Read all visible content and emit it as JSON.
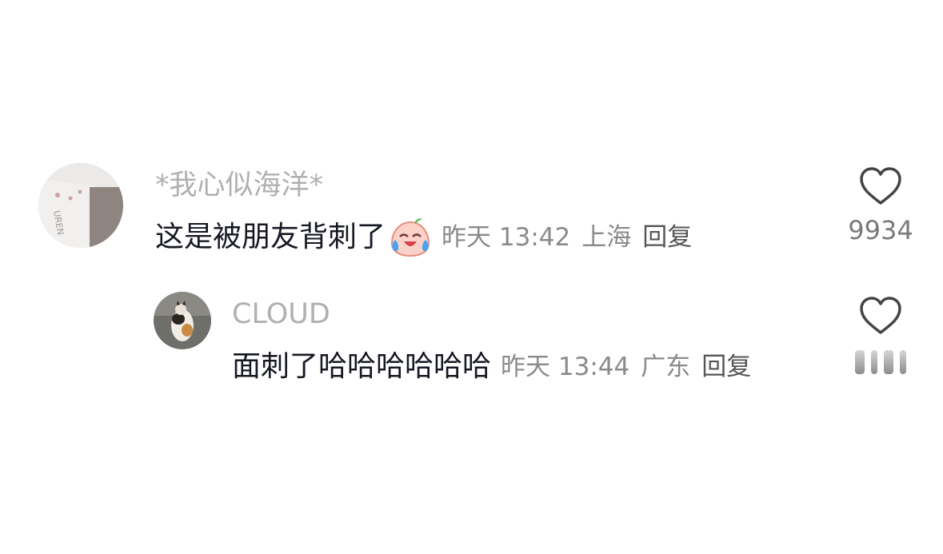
{
  "comments": [
    {
      "username": "*我心似海洋*",
      "text": "这是被朋友背刺了",
      "emoji_icon": "crying-laughing-face-icon",
      "time": "昨天 13:42",
      "location": "上海",
      "reply_label": "回复",
      "like_count": "9934"
    }
  ],
  "replies": [
    {
      "username": "CLOUD",
      "text": "面刺了哈哈哈哈哈哈",
      "time": "昨天 13:44",
      "location": "广东",
      "reply_label": "回复",
      "like_count_obscured": true
    }
  ],
  "colors": {
    "username": "#b0b0b0",
    "text": "#161823",
    "meta": "#8a8a8a",
    "icon": "#444444"
  }
}
